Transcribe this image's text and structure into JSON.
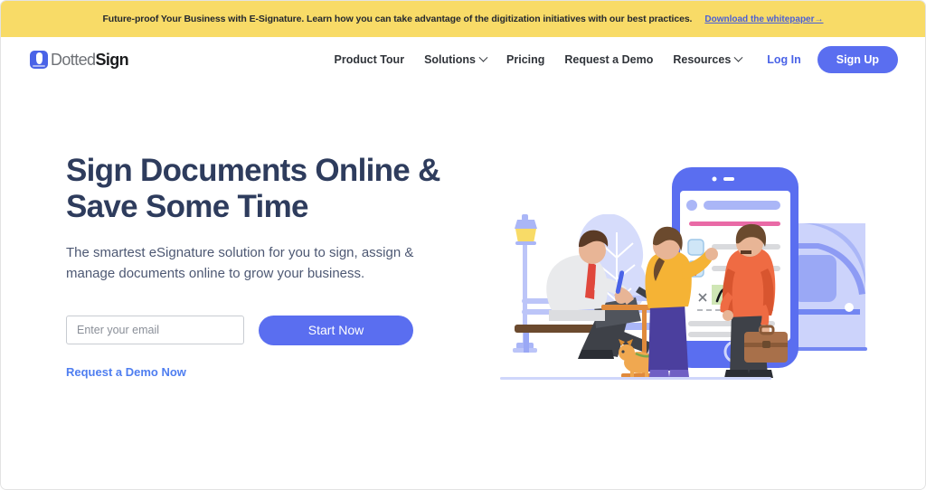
{
  "promo": {
    "text": "Future-proof Your Business with E-Signature. Learn how you can take advantage of the digitization initiatives with our best practices.",
    "link_label": "Download the whitepaper→",
    "background": "#f8db67",
    "link_color": "#4a5fd6"
  },
  "header": {
    "logo": {
      "icon": "dottedsign-pen-mark-icon",
      "word_1": "Dotted",
      "word_2": "Sign"
    },
    "nav": [
      {
        "label": "Product Tour",
        "has_caret": false
      },
      {
        "label": "Solutions",
        "has_caret": true
      },
      {
        "label": "Pricing",
        "has_caret": false
      },
      {
        "label": "Request a Demo",
        "has_caret": false
      },
      {
        "label": "Resources",
        "has_caret": true
      }
    ],
    "login_label": "Log In",
    "signup_label": "Sign Up",
    "accent_color": "#5a6ef0"
  },
  "hero": {
    "title": "Sign Documents Online &\nSave Some Time",
    "subtitle": "The smartest eSignature solution for you to sign, assign &\nmanage documents online to grow your business.",
    "email_placeholder": "Enter your email",
    "email_value": "",
    "start_label": "Start Now",
    "demo_label": "Request a Demo Now",
    "title_color": "#2e3c5d",
    "subtitle_color": "#4d5873"
  },
  "illustration": {
    "name": "esignature-hero-illustration",
    "elements": [
      "street-lamp",
      "park-bench",
      "seated-man-with-laptop",
      "tree-silhouette",
      "woman-pointing-at-phone",
      "dog",
      "giant-smartphone-document",
      "man-with-briefcase",
      "train"
    ],
    "palette": {
      "phone_frame": "#5a6ef0",
      "train_light": "#ccd3fb",
      "train_mid": "#aab6f7",
      "train_dark": "#7286f2",
      "signature_highlight": "#cfe6b5",
      "woman_top": "#f5b335",
      "woman_pants": "#4b3f9e",
      "man_coat": "#ef6b43",
      "lamp_light": "#f8db67",
      "dog": "#f0a850",
      "doc_pink_line": "#e96aa6"
    }
  }
}
